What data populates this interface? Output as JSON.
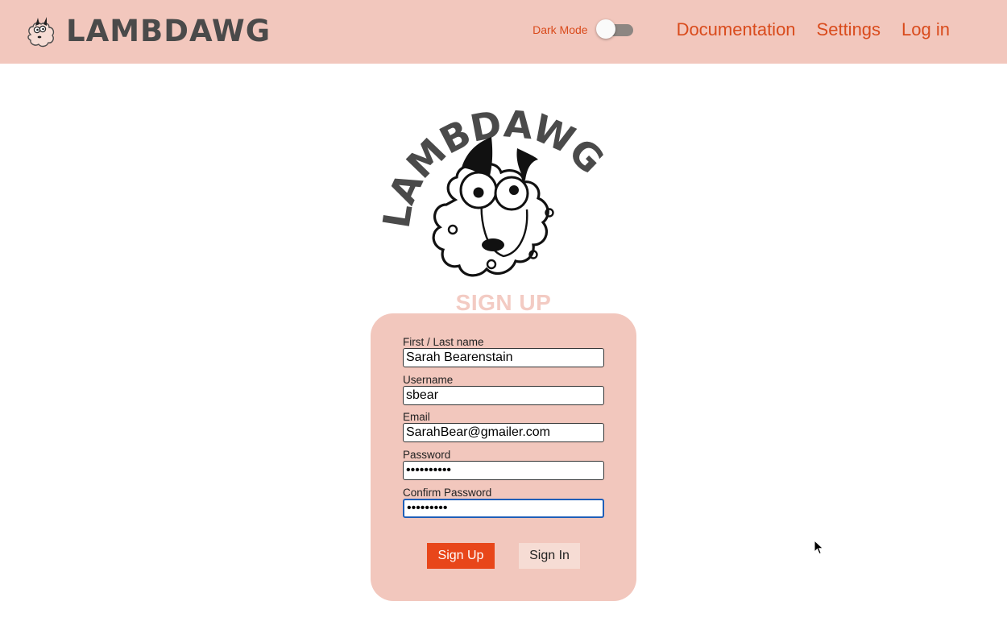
{
  "header": {
    "brand_name": "LAMBDAWG",
    "dark_mode_label": "Dark Mode",
    "dark_mode_on": false,
    "nav": [
      {
        "label": "Documentation"
      },
      {
        "label": "Settings"
      },
      {
        "label": "Log in"
      }
    ]
  },
  "hero": {
    "logo_text": "LAMBDAWG"
  },
  "signup": {
    "title": "SIGN UP",
    "fields": [
      {
        "label": "First / Last name",
        "value": "Sarah Bearenstain",
        "type": "text"
      },
      {
        "label": "Username",
        "value": "sbear",
        "type": "text"
      },
      {
        "label": "Email",
        "value": "SarahBear@gmailer.com",
        "type": "text"
      },
      {
        "label": "Password",
        "value": "••••••••••",
        "type": "password"
      },
      {
        "label": "Confirm Password",
        "value": "•••••••••",
        "type": "password"
      }
    ],
    "primary_button": "Sign Up",
    "secondary_button": "Sign In"
  },
  "colors": {
    "header_bg": "#f2c7bd",
    "accent": "#d94b1c",
    "primary_button": "#e8461a",
    "card_bg": "#f2c7bd",
    "title": "#f3cbc3"
  }
}
